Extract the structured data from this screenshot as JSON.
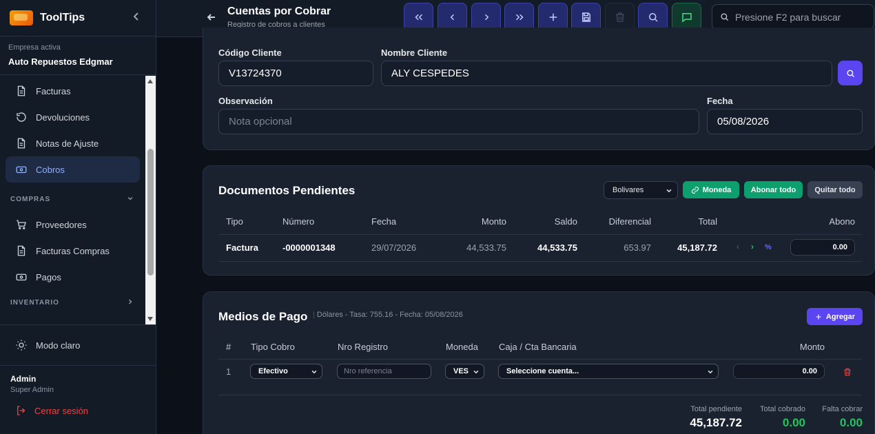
{
  "app": {
    "name": "ToolTips"
  },
  "company": {
    "label": "Empresa activa",
    "name": "Auto Repuestos Edgmar"
  },
  "sidebar": {
    "items": [
      {
        "label": "Facturas"
      },
      {
        "label": "Devoluciones"
      },
      {
        "label": "Notas de Ajuste"
      },
      {
        "label": "Cobros",
        "active": true
      }
    ],
    "section_compras": "COMPRAS",
    "compras_items": [
      {
        "label": "Proveedores"
      },
      {
        "label": "Facturas Compras"
      },
      {
        "label": "Pagos"
      }
    ],
    "section_inventario": "INVENTARIO",
    "theme_toggle": "Modo claro",
    "user": {
      "name": "Admin",
      "role": "Super Admin"
    },
    "logout": "Cerrar sesión"
  },
  "header": {
    "title": "Cuentas por Cobrar",
    "subtitle": "Registro de cobros a clientes",
    "search_placeholder": "Presione F2 para buscar"
  },
  "form": {
    "client_code_label": "Código Cliente",
    "client_code": "V13724370",
    "client_name_label": "Nombre Cliente",
    "client_name": "ALY CESPEDES",
    "observation_label": "Observación",
    "observation_placeholder": "Nota opcional",
    "date_label": "Fecha",
    "date": "05/08/2026"
  },
  "pending": {
    "title": "Documentos Pendientes",
    "currency_select": "Bolivares",
    "moneda_button": "Moneda",
    "abonar_button": "Abonar todo",
    "quitar_button": "Quitar todo",
    "columns": [
      "Tipo",
      "Número",
      "Fecha",
      "Monto",
      "Saldo",
      "Diferencial",
      "Total",
      "Abono"
    ],
    "rows": [
      {
        "tipo": "Factura",
        "numero": "-0000001348",
        "fecha": "29/07/2026",
        "monto": "44,533.75",
        "saldo": "44,533.75",
        "diferencial": "653.97",
        "total": "45,187.72",
        "abono": "0.00"
      }
    ],
    "row_controls": {
      "prev": "‹",
      "next": "›",
      "percent": "%"
    }
  },
  "payments": {
    "title": "Medios de Pago",
    "info": "Dólares - Tasa: 755.16 - Fecha: 05/08/2026",
    "add_button": "Agregar",
    "columns": [
      "#",
      "Tipo Cobro",
      "Nro Registro",
      "Moneda",
      "Caja / Cta Bancaria",
      "Monto"
    ],
    "rows": [
      {
        "n": "1",
        "tipo": "Efectivo",
        "registro_placeholder": "Nro referencia",
        "moneda": "VES",
        "caja": "Seleccione cuenta...",
        "monto": "0.00"
      }
    ],
    "totals": {
      "pendiente_label": "Total pendiente",
      "pendiente": "45,187.72",
      "cobrado_label": "Total cobrado",
      "cobrado": "0.00",
      "falta_label": "Falta cobrar",
      "falta": "0.00"
    }
  },
  "colors": {
    "accent": "#5b45f0",
    "active_nav": "#8fb2ff",
    "success": "#0e9f6e",
    "danger": "#ef4444",
    "total_green": "#22c55e"
  }
}
